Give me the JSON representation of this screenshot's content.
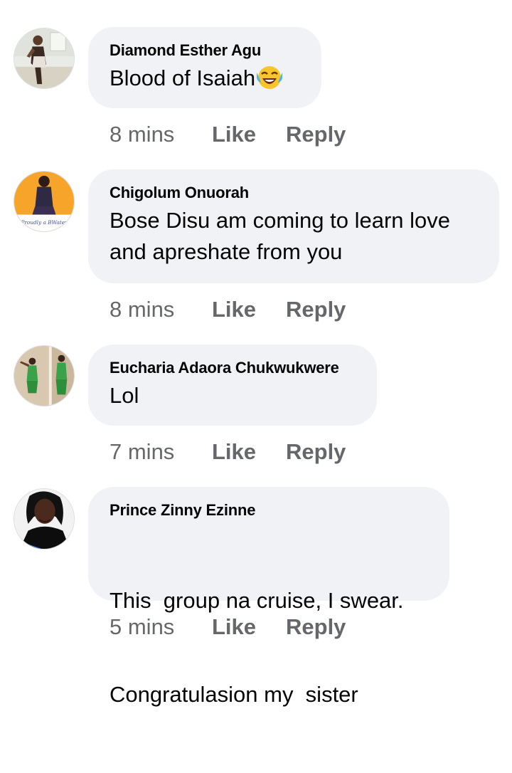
{
  "comments": [
    {
      "author": "Diamond Esther Agu",
      "text": "Blood of Isaiah",
      "emoji": "tears-of-joy-emoji",
      "time": "8 mins",
      "like_label": "Like",
      "reply_label": "Reply"
    },
    {
      "author": "Chigolum Onuorah",
      "lines": [
        "Bose Disu am coming to learn love",
        "and apreshate from you"
      ],
      "avatar_caption": "Proudly a BWater",
      "time": "8 mins",
      "like_label": "Like",
      "reply_label": "Reply"
    },
    {
      "author": "Eucharia Adaora Chukwukwere",
      "text": "Lol",
      "time": "7 mins",
      "like_label": "Like",
      "reply_label": "Reply"
    },
    {
      "author": "Prince Zinny Ezinne",
      "lines": [
        "This  group na cruise, I swear.",
        "Congratulasion my  sister"
      ],
      "time": "5 mins",
      "like_label": "Like",
      "reply_label": "Reply"
    }
  ],
  "colors": {
    "bubble_bg": "#f0f2f5",
    "author_text": "#050505",
    "meta_text": "#65676b"
  }
}
